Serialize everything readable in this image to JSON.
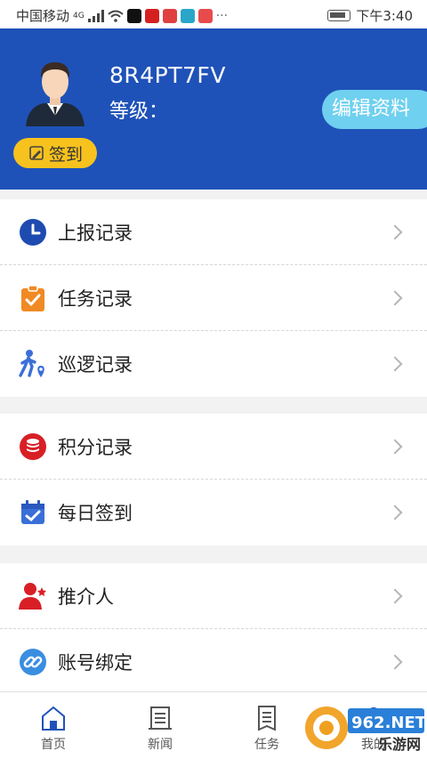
{
  "status_bar": {
    "carrier": "中国移动",
    "network": "4G",
    "time": "下午3:40"
  },
  "profile": {
    "username": "8R4PT7FV",
    "level_label": "等级：",
    "edit_button": "编辑资料",
    "checkin_button": "签到"
  },
  "menu_groups": [
    [
      {
        "label": "上报记录",
        "icon": "clock-icon"
      },
      {
        "label": "任务记录",
        "icon": "clipboard-check-icon"
      },
      {
        "label": "巡逻记录",
        "icon": "walker-pin-icon"
      }
    ],
    [
      {
        "label": "积分记录",
        "icon": "coin-stack-icon"
      },
      {
        "label": "每日签到",
        "icon": "calendar-check-icon"
      }
    ],
    [
      {
        "label": "推介人",
        "icon": "user-star-icon"
      },
      {
        "label": "账号绑定",
        "icon": "link-icon"
      }
    ]
  ],
  "tab_bar": [
    {
      "label": "首页",
      "icon": "home-icon"
    },
    {
      "label": "新闻",
      "icon": "news-icon"
    },
    {
      "label": "任务",
      "icon": "task-icon"
    },
    {
      "label": "我的",
      "icon": "user-icon"
    }
  ],
  "watermark": {
    "text": "962.NET",
    "subtext": "乐游网"
  },
  "colors": {
    "header_bg": "#1f52b8",
    "edit_button_bg": "#6fd0ef",
    "checkin_button_bg": "#f7c21e"
  }
}
